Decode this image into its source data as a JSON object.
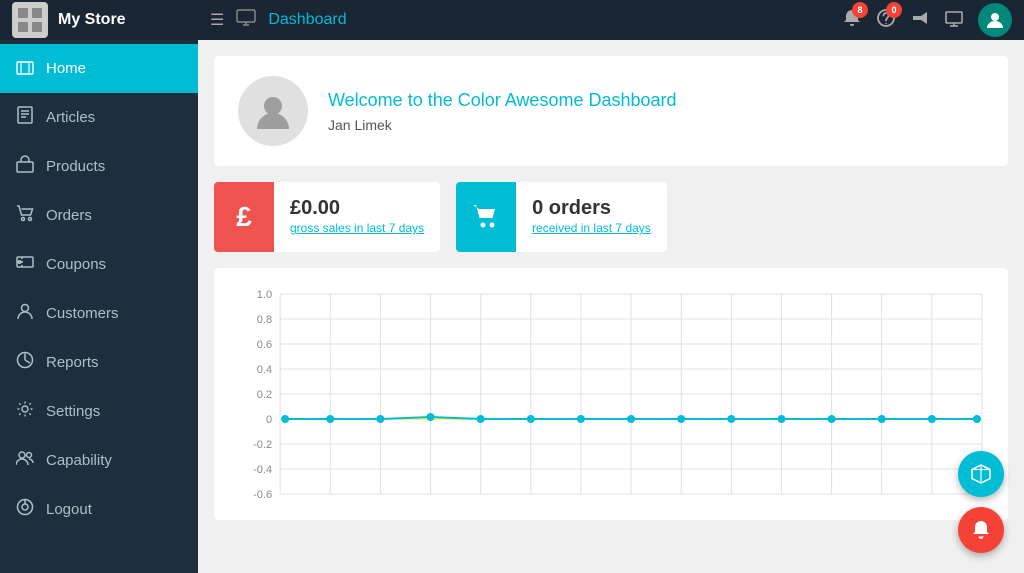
{
  "header": {
    "brand_name": "My Store",
    "title": "Dashboard",
    "notification_badge": "8",
    "help_badge": "0",
    "menu_icon": "☰",
    "monitor_icon": "🖥"
  },
  "sidebar": {
    "items": [
      {
        "id": "home",
        "label": "Home",
        "icon": "⊞",
        "active": true
      },
      {
        "id": "articles",
        "label": "Articles",
        "icon": "📄",
        "active": false
      },
      {
        "id": "products",
        "label": "Products",
        "icon": "🎁",
        "active": false
      },
      {
        "id": "orders",
        "label": "Orders",
        "icon": "🛒",
        "active": false
      },
      {
        "id": "coupons",
        "label": "Coupons",
        "icon": "🏷",
        "active": false
      },
      {
        "id": "customers",
        "label": "Customers",
        "icon": "👤",
        "active": false
      },
      {
        "id": "reports",
        "label": "Reports",
        "icon": "📊",
        "active": false
      },
      {
        "id": "settings",
        "label": "Settings",
        "icon": "⚙",
        "active": false
      },
      {
        "id": "capability",
        "label": "Capability",
        "icon": "👥",
        "active": false
      },
      {
        "id": "logout",
        "label": "Logout",
        "icon": "⏻",
        "active": false
      }
    ]
  },
  "welcome": {
    "title": "Welcome to the Color Awesome Dashboard",
    "user": "Jan Limek"
  },
  "stats": [
    {
      "id": "sales",
      "icon": "£",
      "color": "red",
      "value": "£0.00",
      "label": "gross sales in last 7 days"
    },
    {
      "id": "orders",
      "icon": "🛒",
      "color": "teal",
      "value": "0 orders",
      "label": "received in last 7 days"
    }
  ],
  "chart": {
    "y_labels": [
      "1.0",
      "0.8",
      "0.6",
      "0.4",
      "0.2",
      "0",
      "-0.2",
      "-0.4",
      "-0.6"
    ],
    "line_color": "#00bcd4",
    "zero_line_color": "#ffeb3b"
  },
  "fabs": [
    {
      "id": "box",
      "icon": "⬡",
      "color": "teal"
    },
    {
      "id": "bell",
      "icon": "🔔",
      "color": "red"
    }
  ]
}
